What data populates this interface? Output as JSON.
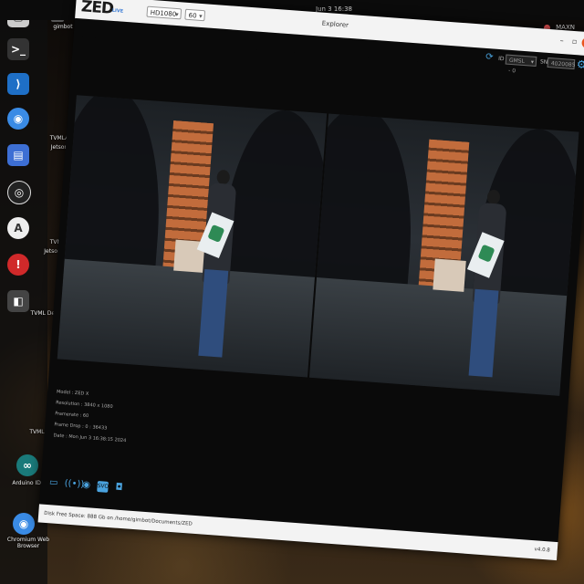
{
  "desktop": {
    "clock": "Jun 3  16:38",
    "tray_label": "MAXN",
    "desktop_labels": [
      "gimbot",
      "TVMLA",
      "Jetson",
      "TVMLA",
      "Jetson\nFour",
      "TVML\nDevelop",
      "TVML\nCommun",
      "Arduino IDE",
      "Chromium Web\nBrowser"
    ]
  },
  "window": {
    "title": "Explorer",
    "logo": "ZED",
    "logo_sub": "LIVE",
    "resolution_select": "HD1080",
    "fps_select": "60",
    "camera": {
      "id_label": "ID",
      "id_value": "GMSL - 0",
      "sn_label": "SN",
      "sn_value": "4020085"
    },
    "info": {
      "model": "Model : ZED X",
      "resolution": "Resolution : 3840 x 1080",
      "framerate": "Framerate : 60",
      "frame_drop": "Frame Drop : 0 : 36433",
      "date": "Date : Mon Jun 3 16:38:15 2024"
    },
    "status_left": "Disk Free Space: 888 Gb  on  /home/gimbot/Documents/ZED",
    "status_right": "v4.0.8",
    "icons": {
      "folder": "folder-icon",
      "wifi": "wireless-icon",
      "record": "record-icon",
      "svo": "svo-icon",
      "camera": "camera-icon"
    },
    "accent": "#4aa3df"
  }
}
